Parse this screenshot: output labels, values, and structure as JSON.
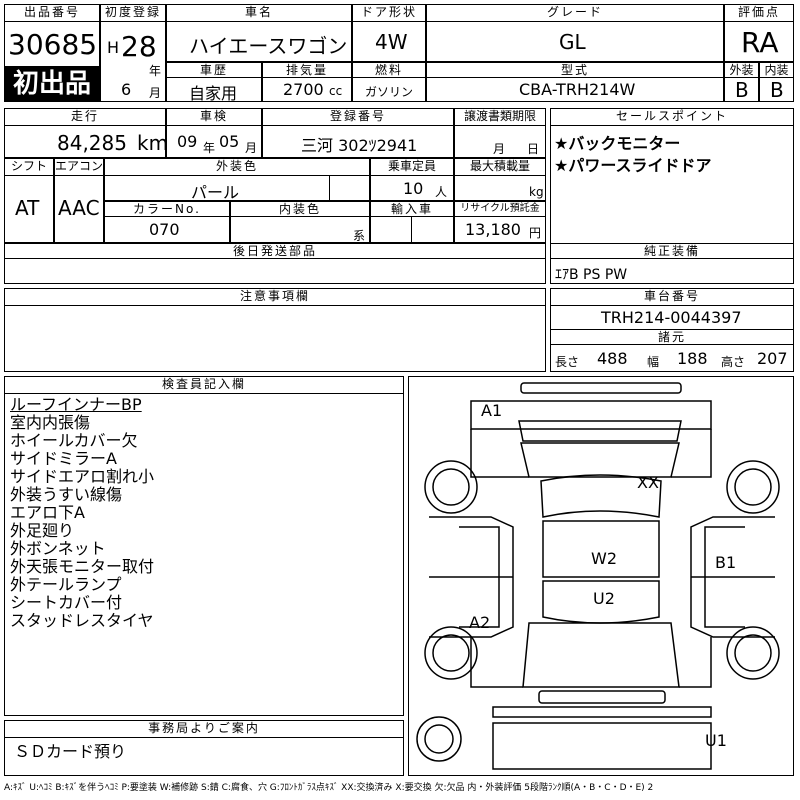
{
  "header": {
    "lot_number_label": "出品番号",
    "lot_number": "30685",
    "first_listing": "初出品",
    "first_reg_label": "初度登録",
    "era": "H",
    "year": "28",
    "year_unit": "年",
    "month": "6",
    "month_unit": "月",
    "model_name_label": "車名",
    "model_name": "ハイエースワゴン",
    "door_label": "ドア形状",
    "door": "4W",
    "grade_label": "グレード",
    "grade": "GL",
    "score_label": "評価点",
    "score": "RA",
    "history_label": "車歴",
    "history": "自家用",
    "displacement_label": "排気量",
    "displacement": "2700",
    "displacement_unit": "cc",
    "fuel_label": "燃料",
    "fuel": "ガソリン",
    "model_code_label": "型式",
    "model_code": "CBA-TRH214W",
    "exterior_grade_label": "外装",
    "exterior_grade": "B",
    "interior_grade_label": "内装",
    "interior_grade": "B"
  },
  "row2": {
    "mileage_label": "走行",
    "mileage": "84,285",
    "mileage_unit": "km",
    "inspection_label": "車検",
    "inspection_year": "09",
    "inspection_year_unit": "年",
    "inspection_month": "05",
    "inspection_month_unit": "月",
    "plate_label": "登録番号",
    "plate": "三河 302ﾂ2941",
    "transfer_label": "譲渡書類期限",
    "transfer_month_unit": "月",
    "transfer_day_unit": "日",
    "selling_points_label": "セールスポイント",
    "selling_points": [
      "★バックモニター",
      "★パワースライドドア"
    ]
  },
  "row3": {
    "shift_label": "シフト",
    "shift": "AT",
    "aircon_label": "エアコン",
    "aircon": "AAC",
    "ext_color_label": "外装色",
    "ext_color": "パール",
    "capacity_label": "乗車定員",
    "capacity": "10",
    "capacity_unit": "人",
    "load_label": "最大積載量",
    "load_unit": "kg",
    "color_no_label": "カラーNo.",
    "color_no": "070",
    "int_color_label": "内装色",
    "int_color_unit": "系",
    "import_label": "輸入車",
    "recycle_label": "リサイクル預託金",
    "recycle": "13,180",
    "recycle_unit": "円"
  },
  "parts_later_label": "後日発送部品",
  "equipment_label": "純正装備",
  "equipment": "ｴｱB PS PW",
  "notes_label": "注意事項欄",
  "chassis_label": "車台番号",
  "chassis": "TRH214-0044397",
  "specs_label": "諸元",
  "length_label": "長さ",
  "length": "488",
  "width_label": "幅",
  "width": "188",
  "height_label": "高さ",
  "height": "207",
  "inspector_label": "検査員記入欄",
  "inspector_notes": [
    "ルーフインナーBP",
    "室内内張傷",
    "ホイールカバー欠",
    "サイドミラーA",
    "サイドエアロ割れ小",
    "外装うすい線傷",
    "エアロ下A",
    "外足廻り",
    "外ボンネット",
    "外天張モニター取付",
    "外テールランプ",
    "シートカバー付",
    "スタッドレスタイヤ"
  ],
  "office_label": "事務局よりご案内",
  "office_note": "ＳＤカード預り",
  "diagram_marks": {
    "a1": "A1",
    "xx": "XX",
    "w2": "W2",
    "b1": "B1",
    "u2": "U2",
    "a2": "A2",
    "u1": "U1"
  },
  "legend": "A:ｷｽﾞ U:ﾍｺﾐ B:ｷｽﾞを伴うﾍｺﾐ P:要塗装 W:補修跡 S:錆 C:腐食、穴 G:ﾌﾛﾝﾄｶﾞﾗｽ点ｷｽﾞ XX:交換済み X:要交換 欠:欠品 内・外装評価 5段階ﾗﾝｸ順(A・B・C・D・E) 2"
}
